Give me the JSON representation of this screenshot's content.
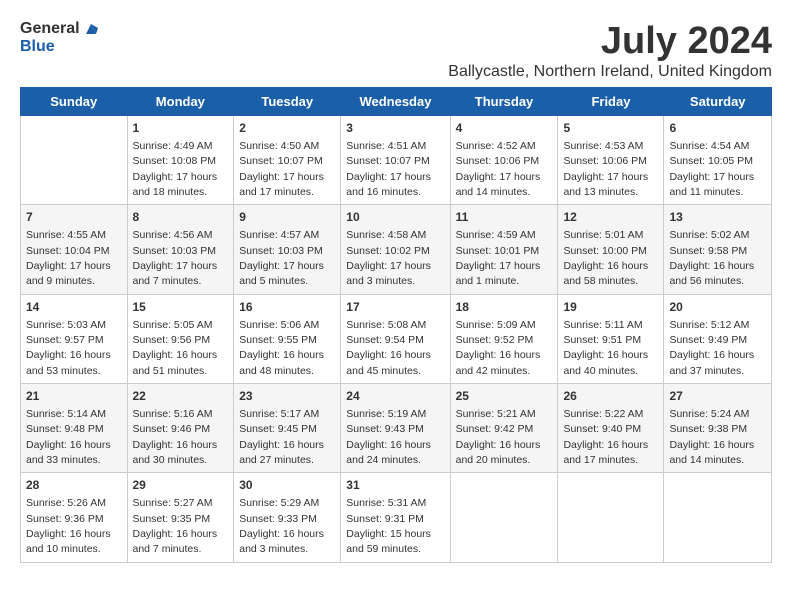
{
  "logo": {
    "general": "General",
    "blue": "Blue"
  },
  "title": "July 2024",
  "subtitle": "Ballycastle, Northern Ireland, United Kingdom",
  "days_of_week": [
    "Sunday",
    "Monday",
    "Tuesday",
    "Wednesday",
    "Thursday",
    "Friday",
    "Saturday"
  ],
  "weeks": [
    [
      {
        "day": "",
        "content": ""
      },
      {
        "day": "1",
        "content": "Sunrise: 4:49 AM\nSunset: 10:08 PM\nDaylight: 17 hours\nand 18 minutes."
      },
      {
        "day": "2",
        "content": "Sunrise: 4:50 AM\nSunset: 10:07 PM\nDaylight: 17 hours\nand 17 minutes."
      },
      {
        "day": "3",
        "content": "Sunrise: 4:51 AM\nSunset: 10:07 PM\nDaylight: 17 hours\nand 16 minutes."
      },
      {
        "day": "4",
        "content": "Sunrise: 4:52 AM\nSunset: 10:06 PM\nDaylight: 17 hours\nand 14 minutes."
      },
      {
        "day": "5",
        "content": "Sunrise: 4:53 AM\nSunset: 10:06 PM\nDaylight: 17 hours\nand 13 minutes."
      },
      {
        "day": "6",
        "content": "Sunrise: 4:54 AM\nSunset: 10:05 PM\nDaylight: 17 hours\nand 11 minutes."
      }
    ],
    [
      {
        "day": "7",
        "content": "Sunrise: 4:55 AM\nSunset: 10:04 PM\nDaylight: 17 hours\nand 9 minutes."
      },
      {
        "day": "8",
        "content": "Sunrise: 4:56 AM\nSunset: 10:03 PM\nDaylight: 17 hours\nand 7 minutes."
      },
      {
        "day": "9",
        "content": "Sunrise: 4:57 AM\nSunset: 10:03 PM\nDaylight: 17 hours\nand 5 minutes."
      },
      {
        "day": "10",
        "content": "Sunrise: 4:58 AM\nSunset: 10:02 PM\nDaylight: 17 hours\nand 3 minutes."
      },
      {
        "day": "11",
        "content": "Sunrise: 4:59 AM\nSunset: 10:01 PM\nDaylight: 17 hours\nand 1 minute."
      },
      {
        "day": "12",
        "content": "Sunrise: 5:01 AM\nSunset: 10:00 PM\nDaylight: 16 hours\nand 58 minutes."
      },
      {
        "day": "13",
        "content": "Sunrise: 5:02 AM\nSunset: 9:58 PM\nDaylight: 16 hours\nand 56 minutes."
      }
    ],
    [
      {
        "day": "14",
        "content": "Sunrise: 5:03 AM\nSunset: 9:57 PM\nDaylight: 16 hours\nand 53 minutes."
      },
      {
        "day": "15",
        "content": "Sunrise: 5:05 AM\nSunset: 9:56 PM\nDaylight: 16 hours\nand 51 minutes."
      },
      {
        "day": "16",
        "content": "Sunrise: 5:06 AM\nSunset: 9:55 PM\nDaylight: 16 hours\nand 48 minutes."
      },
      {
        "day": "17",
        "content": "Sunrise: 5:08 AM\nSunset: 9:54 PM\nDaylight: 16 hours\nand 45 minutes."
      },
      {
        "day": "18",
        "content": "Sunrise: 5:09 AM\nSunset: 9:52 PM\nDaylight: 16 hours\nand 42 minutes."
      },
      {
        "day": "19",
        "content": "Sunrise: 5:11 AM\nSunset: 9:51 PM\nDaylight: 16 hours\nand 40 minutes."
      },
      {
        "day": "20",
        "content": "Sunrise: 5:12 AM\nSunset: 9:49 PM\nDaylight: 16 hours\nand 37 minutes."
      }
    ],
    [
      {
        "day": "21",
        "content": "Sunrise: 5:14 AM\nSunset: 9:48 PM\nDaylight: 16 hours\nand 33 minutes."
      },
      {
        "day": "22",
        "content": "Sunrise: 5:16 AM\nSunset: 9:46 PM\nDaylight: 16 hours\nand 30 minutes."
      },
      {
        "day": "23",
        "content": "Sunrise: 5:17 AM\nSunset: 9:45 PM\nDaylight: 16 hours\nand 27 minutes."
      },
      {
        "day": "24",
        "content": "Sunrise: 5:19 AM\nSunset: 9:43 PM\nDaylight: 16 hours\nand 24 minutes."
      },
      {
        "day": "25",
        "content": "Sunrise: 5:21 AM\nSunset: 9:42 PM\nDaylight: 16 hours\nand 20 minutes."
      },
      {
        "day": "26",
        "content": "Sunrise: 5:22 AM\nSunset: 9:40 PM\nDaylight: 16 hours\nand 17 minutes."
      },
      {
        "day": "27",
        "content": "Sunrise: 5:24 AM\nSunset: 9:38 PM\nDaylight: 16 hours\nand 14 minutes."
      }
    ],
    [
      {
        "day": "28",
        "content": "Sunrise: 5:26 AM\nSunset: 9:36 PM\nDaylight: 16 hours\nand 10 minutes."
      },
      {
        "day": "29",
        "content": "Sunrise: 5:27 AM\nSunset: 9:35 PM\nDaylight: 16 hours\nand 7 minutes."
      },
      {
        "day": "30",
        "content": "Sunrise: 5:29 AM\nSunset: 9:33 PM\nDaylight: 16 hours\nand 3 minutes."
      },
      {
        "day": "31",
        "content": "Sunrise: 5:31 AM\nSunset: 9:31 PM\nDaylight: 15 hours\nand 59 minutes."
      },
      {
        "day": "",
        "content": ""
      },
      {
        "day": "",
        "content": ""
      },
      {
        "day": "",
        "content": ""
      }
    ]
  ]
}
